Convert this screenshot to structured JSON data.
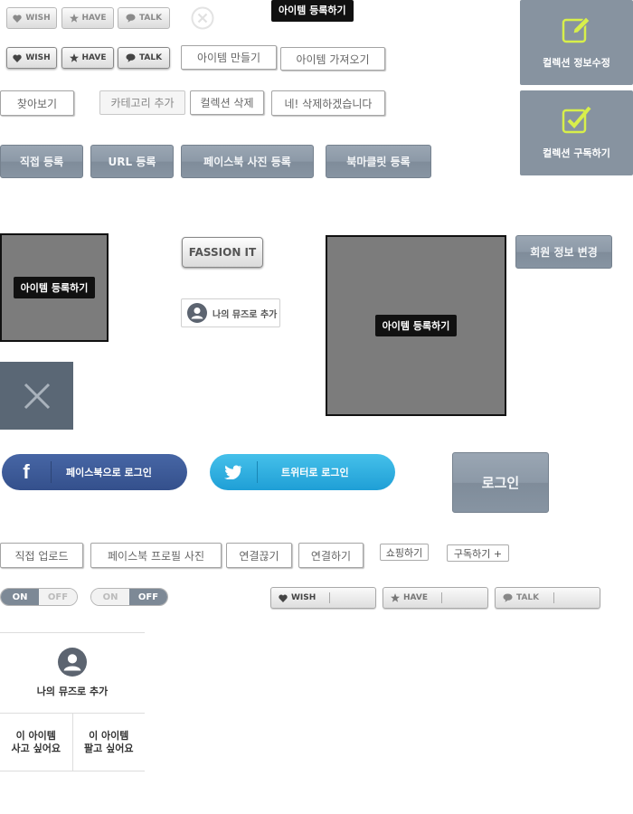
{
  "pills": {
    "wish": "WISH",
    "have": "HAVE",
    "talk": "TALK"
  },
  "tooltip_register": "아이템 등록하기",
  "buttons_row2": {
    "make": "아이템 만들기",
    "import": "아이템 가져오기"
  },
  "buttons_row3": {
    "browse": "찾아보기",
    "add_category": "카테고리 추가",
    "delete_collection": "컬렉션 삭제",
    "confirm_delete": "네! 삭제하겠습니다"
  },
  "tiles": {
    "edit_info": "컬렉션 정보수정",
    "subscribe": "컬렉션 구독하기"
  },
  "register_buttons": {
    "direct": "직접 등록",
    "url": "URL 등록",
    "facebook_photo": "페이스북 사진 등록",
    "bookmarklet": "북마클릿 등록"
  },
  "photo_label_small": "아이템 등록하기",
  "photo_label_large": "아이템 등록하기",
  "fassion_it": "FASSION IT",
  "muse_add_small": "나의 뮤즈로 추가",
  "member_info_change": "회원 정보 변경",
  "login": {
    "facebook": "페이스북으로 로그인",
    "twitter": "트위터로 로그인",
    "plain": "로그인"
  },
  "upload_buttons": {
    "direct_upload": "직접 업로드",
    "fb_profile_photo": "페이스북 프로필 사진",
    "disconnect": "연결끊기",
    "connect": "연결하기"
  },
  "shopping": "쇼핑하기",
  "subscribe_plus": "구독하기 +",
  "toggle": {
    "on": "ON",
    "off": "OFF"
  },
  "muse_panel": {
    "label": "나의 뮤즈로 추가",
    "buy_line1": "이 아이템",
    "buy_line2": "사고 싶어요",
    "sell_line1": "이 아이템",
    "sell_line2": "팔고 싶어요"
  },
  "colors": {
    "bluegray": "#8793a0",
    "facebook": "#3b5998",
    "twitter": "#29a9e0",
    "accent_green": "#c8e63c"
  },
  "icons": [
    "heart-icon",
    "star-icon",
    "speech-bubble-icon",
    "close-circle-icon",
    "pencil-edit-icon",
    "checkbox-check-icon",
    "close-x-icon",
    "user-icon",
    "facebook-f-icon",
    "twitter-bird-icon"
  ]
}
